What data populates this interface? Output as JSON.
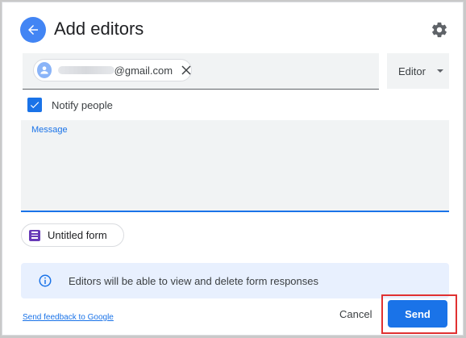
{
  "dialog": {
    "title": "Add editors",
    "back_icon": "arrow-left-icon",
    "settings_icon": "gear-icon"
  },
  "recipients": {
    "chip_email_suffix": "@gmail.com",
    "chip_close_icon": "close-icon"
  },
  "role": {
    "value": "Editor"
  },
  "notify": {
    "label": "Notify people",
    "checked": true
  },
  "message": {
    "label": "Message",
    "value": ""
  },
  "form_chip": {
    "label": "Untitled form",
    "icon": "forms-icon"
  },
  "info": {
    "text": "Editors will be able to view and delete form responses",
    "icon": "info-icon"
  },
  "footer": {
    "feedback_link": "Send feedback to Google",
    "cancel_label": "Cancel",
    "send_label": "Send"
  },
  "colors": {
    "accent": "#1a73e8",
    "highlight": "#e03131",
    "forms_purple": "#673ab7"
  }
}
